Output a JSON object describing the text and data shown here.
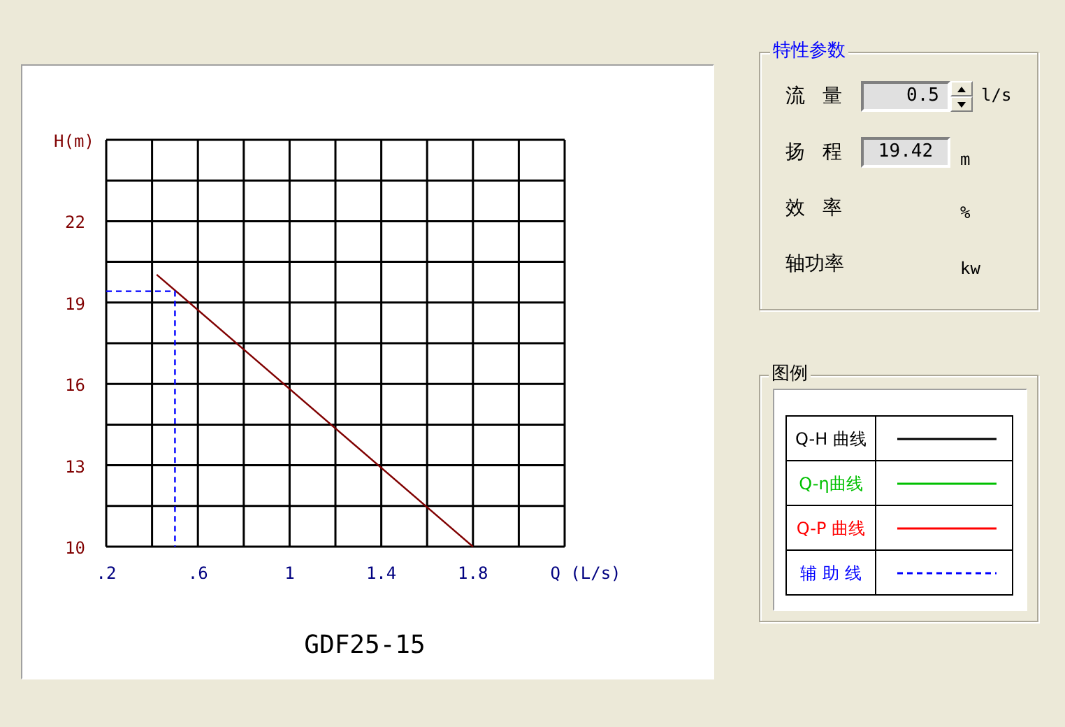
{
  "chart_panel": {
    "chart_data": {
      "type": "line",
      "title": "GDF25-15",
      "xlabel": "Q (L/s)",
      "ylabel": "H(m)",
      "grid": true,
      "series": [
        {
          "color": "#800000",
          "line_style": "solid",
          "x": [
            0.42,
            1.8
          ],
          "values": [
            20.03,
            10
          ]
        },
        {
          "color": "#0000ff",
          "line_style": "dashed",
          "x": [
            0.2,
            0.5,
            0.5
          ],
          "values": [
            19.42,
            19.42,
            10
          ]
        }
      ],
      "xlim": [
        0.2,
        2.2
      ],
      "ylim": [
        10,
        25
      ],
      "xticks": [
        {
          "value": 0.2,
          "label": ".2"
        },
        {
          "value": 0.6,
          "label": ".6"
        },
        {
          "value": 1,
          "label": "1"
        },
        {
          "value": 1.4,
          "label": "1.4"
        },
        {
          "value": 1.8,
          "label": "1.8"
        }
      ],
      "yticks": [
        10,
        13,
        16,
        19,
        22
      ]
    }
  },
  "parameters": {
    "title": "特性参数",
    "rows": [
      {
        "kind": "spinner",
        "label": "流 量",
        "value": "0.5",
        "unit": "l/s"
      },
      {
        "kind": "field",
        "label": "扬 程",
        "value": "19.42",
        "unit": "m"
      },
      {
        "kind": "plain",
        "label": "效 率",
        "unit": "%"
      },
      {
        "kind": "plain",
        "label": "轴功率",
        "unit": "kw"
      }
    ]
  },
  "legend": {
    "title": "图例",
    "items": [
      {
        "label": "Q-H 曲线",
        "color": "#000000",
        "kind": "solid"
      },
      {
        "label": "Q-η曲线",
        "color": "#00c000",
        "kind": "solid"
      },
      {
        "label": "Q-P 曲线",
        "color": "#ff0000",
        "kind": "solid"
      },
      {
        "label": "辅 助 线",
        "color": "#0000ff",
        "kind": "dashed"
      }
    ]
  }
}
